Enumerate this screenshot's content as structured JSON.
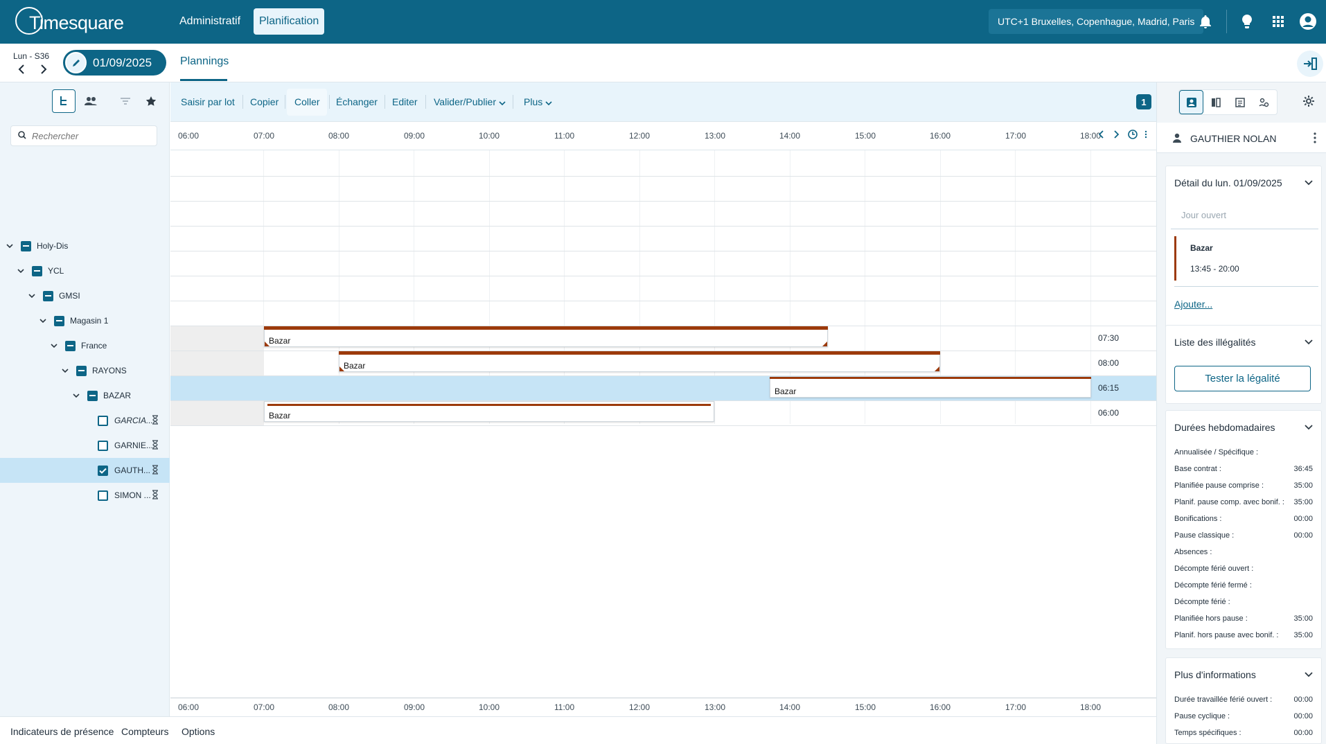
{
  "app": {
    "logo": "Timesquare",
    "nav": [
      "Administratif",
      "Planification"
    ],
    "timezone": "UTC+1 Bruxelles, Copenhague, Madrid, Paris"
  },
  "subbar": {
    "week": "Lun - S36",
    "date": "01/09/2025",
    "tab": "Plannings"
  },
  "search": {
    "placeholder": "Rechercher"
  },
  "tree": [
    {
      "label": "Holy-Dis",
      "type": "group"
    },
    {
      "label": "YCL",
      "type": "group"
    },
    {
      "label": "GMSI",
      "type": "group"
    },
    {
      "label": "Magasin 1",
      "type": "group"
    },
    {
      "label": "France",
      "type": "group"
    },
    {
      "label": "RAYONS",
      "type": "group"
    },
    {
      "label": "BAZAR",
      "type": "group"
    },
    {
      "label": "GARCIA...",
      "type": "person"
    },
    {
      "label": "GARNIE...",
      "type": "person"
    },
    {
      "label": "GAUTH...",
      "type": "person"
    },
    {
      "label": "SIMON ...",
      "type": "person"
    }
  ],
  "toolbar": {
    "items": [
      "Saisir par lot",
      "Copier",
      "Coller",
      "Échanger",
      "Editer",
      "Valider/Publier",
      "Plus"
    ],
    "badge": "1"
  },
  "timeline": {
    "hours": [
      "06:00",
      "07:00",
      "08:00",
      "09:00",
      "10:00",
      "11:00",
      "12:00",
      "13:00",
      "14:00",
      "15:00",
      "16:00",
      "17:00",
      "18:00"
    ]
  },
  "shifts": [
    {
      "label": "Bazar",
      "total": "07:30"
    },
    {
      "label": "Bazar",
      "total": "08:00"
    },
    {
      "label": "Bazar",
      "total": "06:15"
    },
    {
      "label": "Bazar",
      "total": "06:00"
    }
  ],
  "footer": [
    "Indicateurs de présence",
    "Compteurs",
    "Options"
  ],
  "right": {
    "user": "GAUTHIER NOLAN",
    "detail_title": "Détail du lun. 01/09/2025",
    "day_status": "Jour ouvert",
    "activity": "Bazar",
    "activity_time": "13:45 - 20:00",
    "add_link": "Ajouter...",
    "illegal_title": "Liste des illégalités",
    "test_button": "Tester la légalité",
    "weekly_title": "Durées hebdomadaires",
    "weekly": [
      {
        "k": "Annualisée / Spécifique :",
        "v": ""
      },
      {
        "k": "Base contrat :",
        "v": "36:45"
      },
      {
        "k": "Planifiée pause comprise :",
        "v": "35:00"
      },
      {
        "k": "Planif. pause comp. avec bonif. :",
        "v": "35:00"
      },
      {
        "k": "Bonifications :",
        "v": "00:00"
      },
      {
        "k": "Pause classique :",
        "v": "00:00"
      },
      {
        "k": "Absences :",
        "v": ""
      },
      {
        "k": "Décompte férié ouvert :",
        "v": ""
      },
      {
        "k": "Décompte férié fermé :",
        "v": ""
      },
      {
        "k": "Décompte férié :",
        "v": ""
      },
      {
        "k": "Planifiée hors pause :",
        "v": "35:00"
      },
      {
        "k": "Planif. hors pause avec bonif. :",
        "v": "35:00"
      }
    ],
    "more_title": "Plus d'informations",
    "more": [
      {
        "k": "Durée travaillée férié ouvert :",
        "v": "00:00"
      },
      {
        "k": "Pause cyclique :",
        "v": "00:00"
      },
      {
        "k": "Temps spécifiques :",
        "v": "00:00"
      }
    ]
  },
  "colors": {
    "primary": "#0d6586",
    "shift_bar": "#9c3a0b",
    "selection": "#c6e4f6"
  }
}
